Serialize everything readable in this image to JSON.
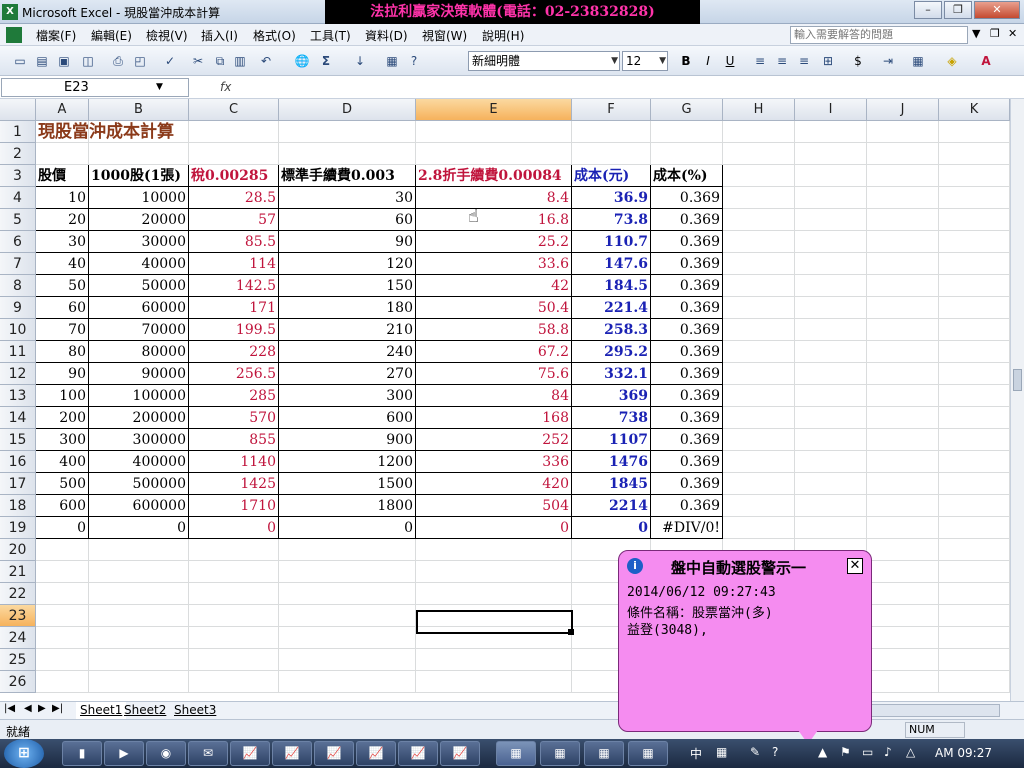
{
  "window": {
    "title": "Microsoft Excel - 現股當沖成本計算",
    "ad_banner": "法拉利贏家決策軟體(電話：02-23832828)",
    "app_icon": "X"
  },
  "menu": {
    "items": [
      "檔案(F)",
      "編輯(E)",
      "檢視(V)",
      "插入(I)",
      "格式(O)",
      "工具(T)",
      "資料(D)",
      "視窗(W)",
      "說明(H)"
    ],
    "help_placeholder": "輸入需要解答的問題"
  },
  "toolbar": {
    "font": "新細明體",
    "size": "12",
    "bold": "B",
    "italic": "I",
    "underline": "U",
    "sum": "Σ",
    "currency": "$",
    "font_color": "A"
  },
  "formula_bar": {
    "name_box": "E23",
    "fx": "fx",
    "content": ""
  },
  "columns": [
    "A",
    "B",
    "C",
    "D",
    "E",
    "F",
    "G",
    "H",
    "I",
    "J",
    "K"
  ],
  "active_column": "E",
  "rows": [
    "1",
    "2",
    "3",
    "4",
    "5",
    "6",
    "7",
    "8",
    "9",
    "10",
    "11",
    "12",
    "13",
    "14",
    "15",
    "16",
    "17",
    "18",
    "19",
    "20",
    "21",
    "22",
    "23",
    "24",
    "25",
    "26"
  ],
  "active_row": "23",
  "sheet": {
    "title": "現股當沖成本計算",
    "headers": [
      "股價",
      "1000股(1張)",
      "稅0.00285",
      "標準手續費0.003",
      "2.8折手續費0.00084",
      "成本(元)",
      "成本(%)"
    ],
    "data": [
      [
        "10",
        "10000",
        "28.5",
        "30",
        "8.4",
        "36.9",
        "0.369"
      ],
      [
        "20",
        "20000",
        "57",
        "60",
        "16.8",
        "73.8",
        "0.369"
      ],
      [
        "30",
        "30000",
        "85.5",
        "90",
        "25.2",
        "110.7",
        "0.369"
      ],
      [
        "40",
        "40000",
        "114",
        "120",
        "33.6",
        "147.6",
        "0.369"
      ],
      [
        "50",
        "50000",
        "142.5",
        "150",
        "42",
        "184.5",
        "0.369"
      ],
      [
        "60",
        "60000",
        "171",
        "180",
        "50.4",
        "221.4",
        "0.369"
      ],
      [
        "70",
        "70000",
        "199.5",
        "210",
        "58.8",
        "258.3",
        "0.369"
      ],
      [
        "80",
        "80000",
        "228",
        "240",
        "67.2",
        "295.2",
        "0.369"
      ],
      [
        "90",
        "90000",
        "256.5",
        "270",
        "75.6",
        "332.1",
        "0.369"
      ],
      [
        "100",
        "100000",
        "285",
        "300",
        "84",
        "369",
        "0.369"
      ],
      [
        "200",
        "200000",
        "570",
        "600",
        "168",
        "738",
        "0.369"
      ],
      [
        "300",
        "300000",
        "855",
        "900",
        "252",
        "1107",
        "0.369"
      ],
      [
        "400",
        "400000",
        "1140",
        "1200",
        "336",
        "1476",
        "0.369"
      ],
      [
        "500",
        "500000",
        "1425",
        "1500",
        "420",
        "1845",
        "0.369"
      ],
      [
        "600",
        "600000",
        "1710",
        "1800",
        "504",
        "2214",
        "0.369"
      ],
      [
        "0",
        "0",
        "0",
        "0",
        "0",
        "0",
        "#DIV/0!"
      ]
    ]
  },
  "sheet_tabs": [
    "Sheet1",
    "Sheet2",
    "Sheet3"
  ],
  "status": {
    "ready": "就緒",
    "num": "NUM"
  },
  "popup": {
    "title": "盤中自動選股警示一",
    "close": "✕",
    "info_icon": "i",
    "line1": "2014/06/12 09:27:43",
    "line2": "條件名稱：股票當沖(多)",
    "line3": "益登(3048),"
  },
  "taskbar": {
    "start": "⊞",
    "clock": "AM 09:27",
    "ime": "中"
  },
  "colors": {
    "red_text": "#c0143c",
    "blue_text": "#1a22b4",
    "title_brown": "#8b3a1a",
    "popup_bg": "#f58cf0",
    "banner_text": "#ff33aa"
  }
}
